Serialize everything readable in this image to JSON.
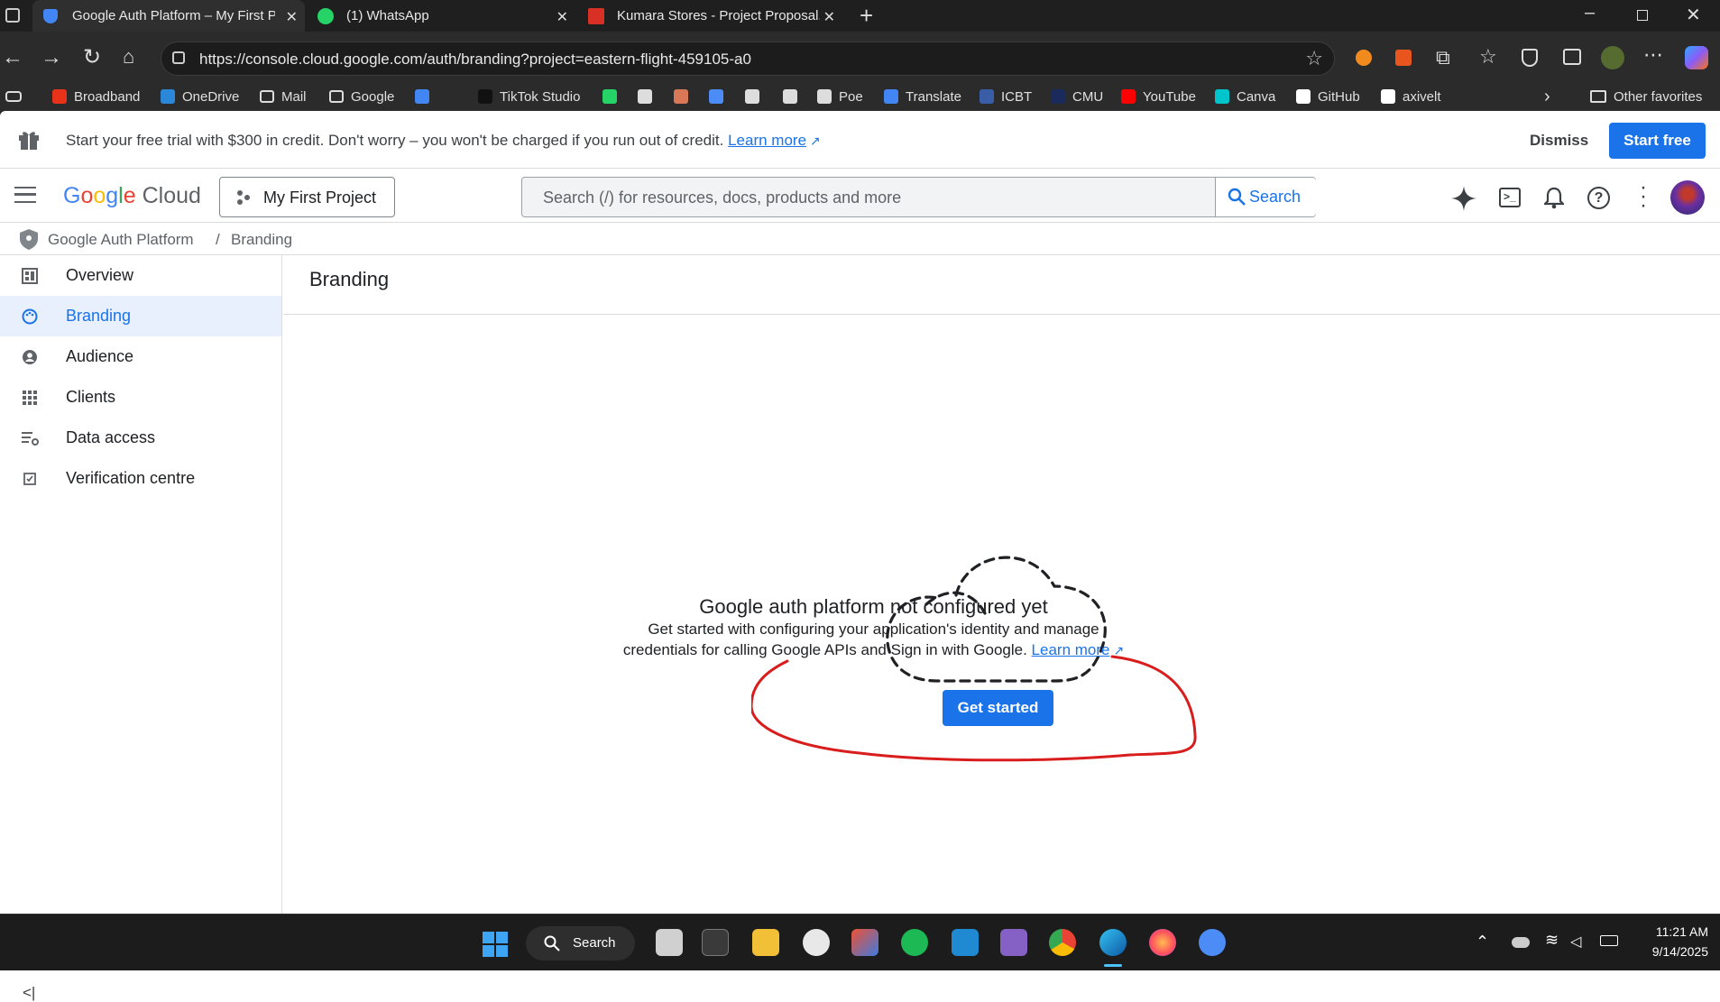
{
  "tabs": [
    {
      "label": "Google Auth Platform – My First P",
      "icon": "shield-icon",
      "active": true
    },
    {
      "label": "(1) WhatsApp",
      "icon": "whatsapp-icon",
      "active": false
    },
    {
      "label": "Kumara Stores - Project Proposal.",
      "icon": "pdf-icon",
      "active": false
    }
  ],
  "address_bar": {
    "url": "https://console.cloud.google.com/auth/branding?project=eastern-flight-459105-a0"
  },
  "favorites": [
    {
      "label": "Broadband",
      "color": "#e8321a"
    },
    {
      "label": "OneDrive",
      "color": "#2b88d8"
    },
    {
      "label": "Mail",
      "color": "folder"
    },
    {
      "label": "Google",
      "color": "folder"
    },
    {
      "label": "",
      "color": "#4285f4"
    },
    {
      "label": "TikTok Studio",
      "color": "#111111"
    },
    {
      "label": "",
      "color": "#25d366"
    },
    {
      "label": "",
      "color": "#dddddd"
    },
    {
      "label": "",
      "color": "#d97757"
    },
    {
      "label": "",
      "color": "#4b8cf7"
    },
    {
      "label": "",
      "color": "#dddddd"
    },
    {
      "label": "",
      "color": "#dddddd"
    },
    {
      "label": "Poe",
      "color": "#dddddd"
    },
    {
      "label": "Translate",
      "color": "#4285f4"
    },
    {
      "label": "ICBT",
      "color": "#3a5da8"
    },
    {
      "label": "CMU",
      "color": "#1a2a5a"
    },
    {
      "label": "YouTube",
      "color": "#ff0000"
    },
    {
      "label": "Canva",
      "color": "#00c4cc"
    },
    {
      "label": "GitHub",
      "color": "#ffffff"
    },
    {
      "label": "axivelt",
      "color": "#ffffff"
    }
  ],
  "other_favorites": "Other favorites",
  "promo": {
    "text": "Start your free trial with $300 in credit. Don't worry – you won't be charged if you run out of credit.",
    "learn_more": "Learn more",
    "dismiss": "Dismiss",
    "start_free": "Start free"
  },
  "header": {
    "logo": "Google Cloud",
    "project": "My First Project",
    "search_placeholder": "Search (/) for resources, docs, products and more",
    "search_button": "Search"
  },
  "breadcrumb": {
    "product": "Google Auth Platform",
    "separator": "/",
    "page": "Branding"
  },
  "sidebar": {
    "items": [
      {
        "label": "Overview",
        "icon": "dashboard-icon",
        "selected": false
      },
      {
        "label": "Branding",
        "icon": "palette-icon",
        "selected": true
      },
      {
        "label": "Audience",
        "icon": "person-icon",
        "selected": false
      },
      {
        "label": "Clients",
        "icon": "grid-icon",
        "selected": false
      },
      {
        "label": "Data access",
        "icon": "data-settings-icon",
        "selected": false
      },
      {
        "label": "Verification centre",
        "icon": "check-box-icon",
        "selected": false
      }
    ],
    "collapse": "<|"
  },
  "main": {
    "title": "Branding",
    "empty_title": "Google auth platform not configured yet",
    "empty_line1": "Get started with configuring your application's identity and manage",
    "empty_line2": "credentials for calling Google APIs and Sign in with Google.",
    "learn_more": "Learn more",
    "get_started": "Get started"
  },
  "taskbar": {
    "search": "Search",
    "time": "11:21 AM",
    "date": "9/14/2025"
  },
  "colors": {
    "accent": "#1a73e8",
    "annotation": "#d91c1c"
  }
}
